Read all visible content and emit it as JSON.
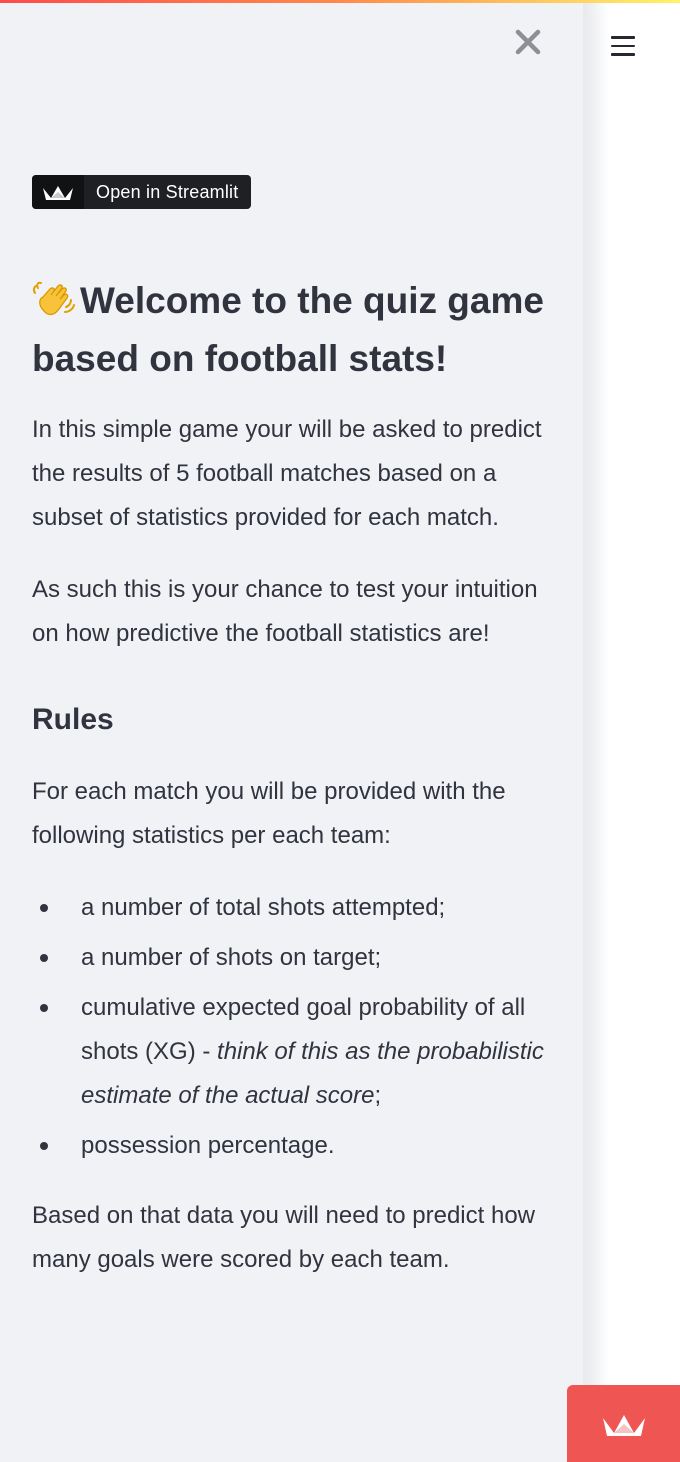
{
  "accent_color": "#ff4b4b",
  "sidebar": {
    "close_icon": "close-icon",
    "badge": {
      "icon": "streamlit-crown-icon",
      "label": "Open in Streamlit"
    },
    "title_emoji": "waving-hand-icon",
    "title": "Welcome to the quiz game based on football stats!",
    "intro": "In this simple game your will be asked to predict the results of 5 football matches based on a subset of statistics provided for each match.",
    "intro2": "As such this is your chance to test your intuition on how predictive the football statistics are!",
    "rules_heading": "Rules",
    "rules_intro": "For each match you will be provided with the following statistics per each team:",
    "rules_list": [
      {
        "text": "a number of total shots attempted;"
      },
      {
        "text": "a number of shots on target;"
      },
      {
        "text": "cumulative expected goal probability of all shots (XG) - ",
        "emph": "think of this as the probabilistic estimate of the actual score",
        "suffix": ";"
      },
      {
        "text": "possession percentage."
      }
    ],
    "rules_outro": "Based on that data you will need to predict how many goals were scored by each team."
  },
  "header": {
    "menu_icon": "hamburger-menu-icon"
  },
  "footer": {
    "corner_icon": "streamlit-crown-icon",
    "corner_color": "#ef5552"
  }
}
